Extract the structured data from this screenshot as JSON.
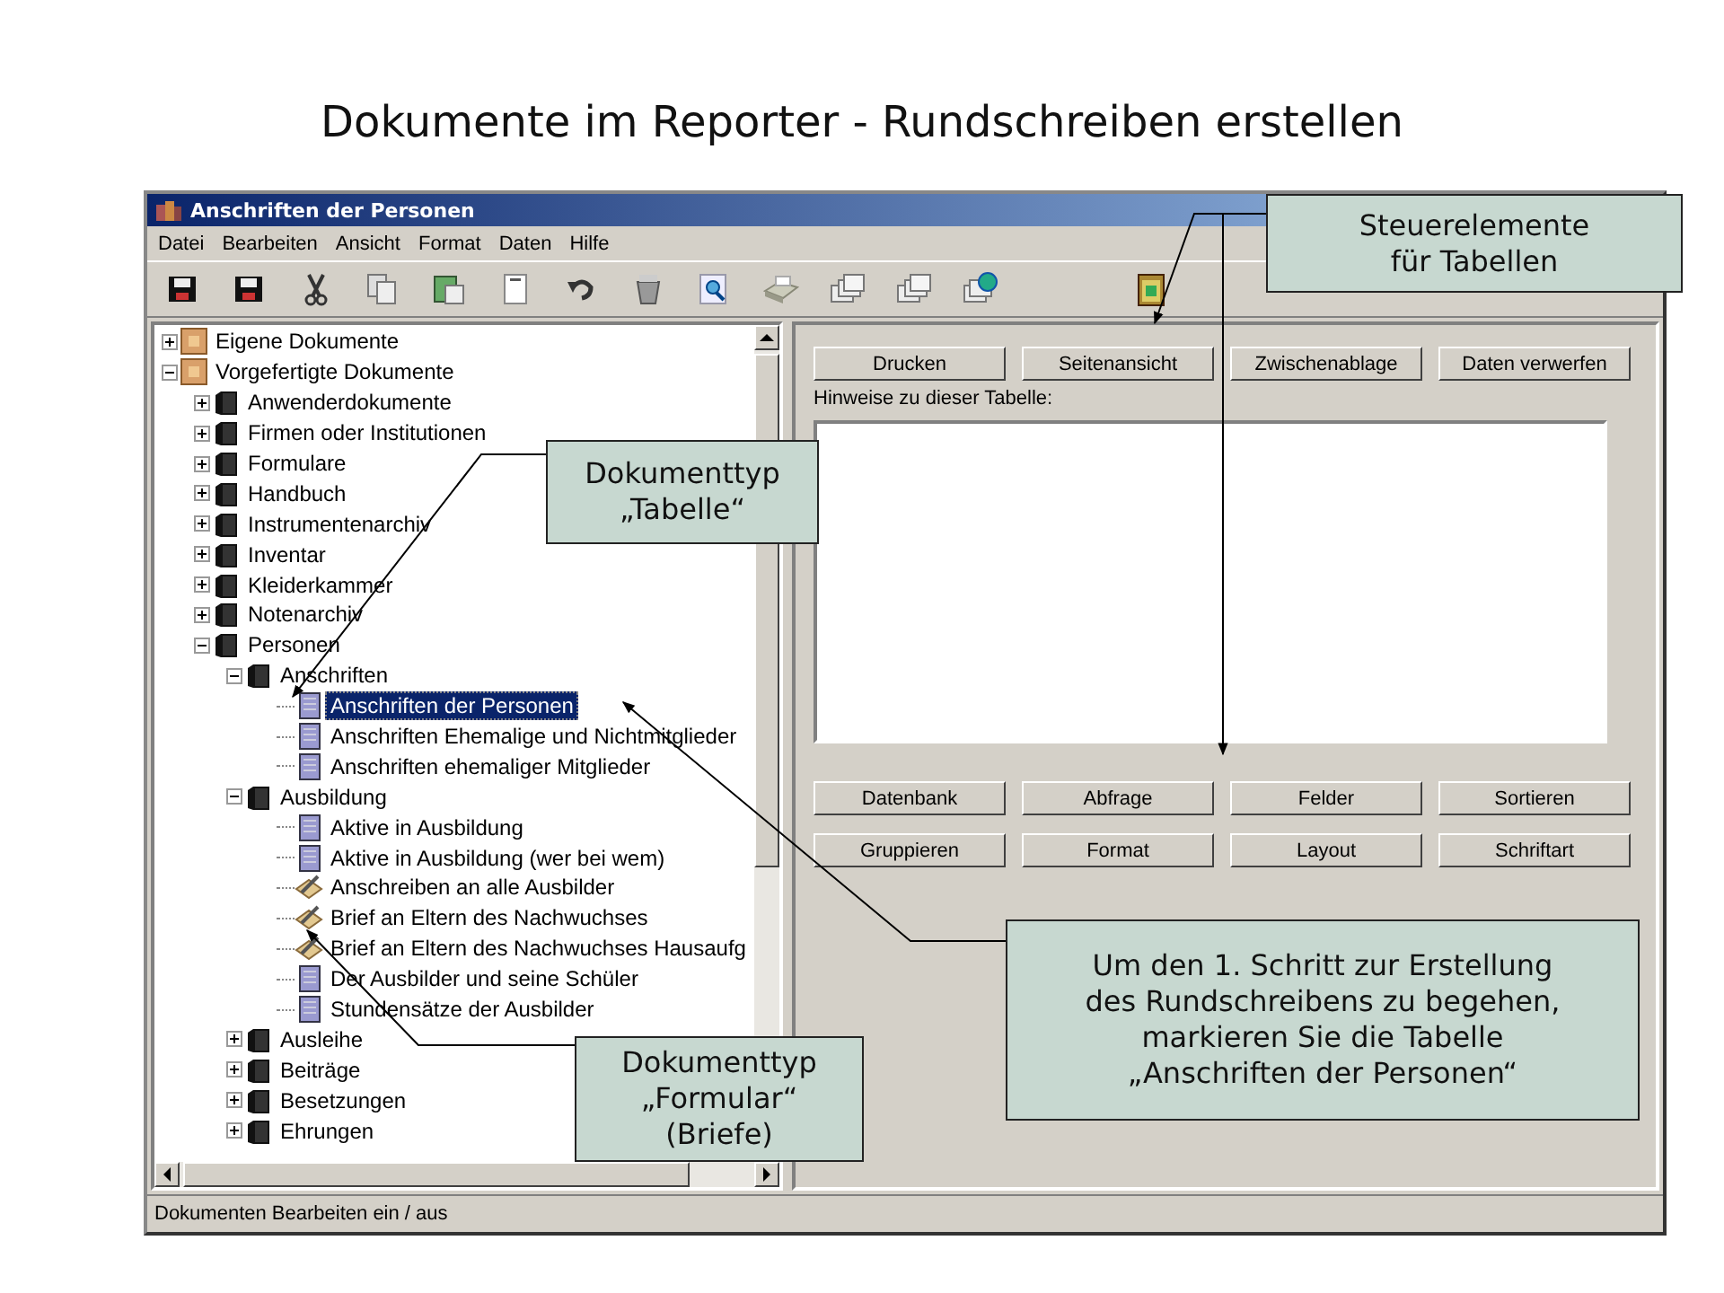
{
  "slide_title": "Dokumente im Reporter - Rundschreiben erstellen",
  "window": {
    "title": "Anschriften der Personen"
  },
  "menu": [
    "Datei",
    "Bearbeiten",
    "Ansicht",
    "Format",
    "Daten",
    "Hilfe"
  ],
  "tree": [
    {
      "label": "Eigene Dokumente",
      "kind": "cabinet",
      "expanded": false,
      "selected": false
    },
    {
      "label": "Vorgefertigte Dokumente",
      "kind": "cabinet",
      "expanded": true,
      "selected": false,
      "children": [
        {
          "label": "Anwenderdokumente",
          "kind": "book",
          "expanded": false,
          "selected": false
        },
        {
          "label": "Firmen oder Institutionen",
          "kind": "book",
          "expanded": false,
          "selected": false
        },
        {
          "label": "Formulare",
          "kind": "book",
          "expanded": false,
          "selected": false
        },
        {
          "label": "Handbuch",
          "kind": "book",
          "expanded": false,
          "selected": false
        },
        {
          "label": "Instrumentenarchiv",
          "kind": "book",
          "expanded": false,
          "selected": false
        },
        {
          "label": "Inventar",
          "kind": "book",
          "expanded": false,
          "selected": false
        },
        {
          "label": "Kleiderkammer",
          "kind": "book",
          "expanded": false,
          "selected": false
        },
        {
          "label": "Notenarchiv",
          "kind": "book",
          "expanded": false,
          "selected": false
        },
        {
          "label": "Personen",
          "kind": "book",
          "expanded": true,
          "selected": false,
          "children": [
            {
              "label": "Anschriften",
              "kind": "book",
              "expanded": true,
              "selected": false,
              "children": [
                {
                  "label": "Anschriften der Personen",
                  "kind": "table",
                  "selected": true
                },
                {
                  "label": "Anschriften Ehemalige und Nichtmitglieder",
                  "kind": "table",
                  "selected": false
                },
                {
                  "label": "Anschriften ehemaliger Mitglieder",
                  "kind": "table",
                  "selected": false
                }
              ]
            },
            {
              "label": "Ausbildung",
              "kind": "book",
              "expanded": true,
              "selected": false,
              "children": [
                {
                  "label": "Aktive in Ausbildung",
                  "kind": "table",
                  "selected": false
                },
                {
                  "label": "Aktive in Ausbildung (wer bei wem)",
                  "kind": "table",
                  "selected": false
                },
                {
                  "label": "Anschreiben an alle Ausbilder",
                  "kind": "letter",
                  "selected": false
                },
                {
                  "label": "Brief an Eltern des Nachwuchses",
                  "kind": "letter",
                  "selected": false
                },
                {
                  "label": "Brief an Eltern des Nachwuchses Hausaufg",
                  "kind": "letter",
                  "selected": false
                },
                {
                  "label": "Der Ausbilder und seine Schüler",
                  "kind": "table",
                  "selected": false
                },
                {
                  "label": "Stundensätze der Ausbilder",
                  "kind": "table",
                  "selected": false
                }
              ]
            },
            {
              "label": "Ausleihe",
              "kind": "book",
              "expanded": false,
              "selected": false
            },
            {
              "label": "Beiträge",
              "kind": "book",
              "expanded": false,
              "selected": false
            },
            {
              "label": "Besetzungen",
              "kind": "book",
              "expanded": false,
              "selected": false
            },
            {
              "label": "Ehrungen",
              "kind": "book",
              "expanded": false,
              "selected": false
            }
          ]
        }
      ]
    }
  ],
  "buttons_top": [
    "Drucken",
    "Seitenansicht",
    "Zwischenablage",
    "Daten verwerfen"
  ],
  "notes_label": "Hinweise zu dieser Tabelle:",
  "button_rows": [
    [
      "Datenbank",
      "Abfrage",
      "Felder",
      "Sortieren"
    ],
    [
      "Gruppieren",
      "Format",
      "Layout",
      "Schriftart"
    ]
  ],
  "status_bar": "Dokumenten Bearbeiten ein / aus",
  "callouts": [
    {
      "lines": [
        "Steuerelemente",
        "für Tabellen"
      ]
    },
    {
      "lines": [
        "Dokumenttyp",
        "„Tabelle“"
      ]
    },
    {
      "lines": [
        "Um den 1. Schritt zur Erstellung",
        "des Rundschreibens zu begehen,",
        "markieren Sie die Tabelle",
        "„Anschriften der Personen“"
      ]
    },
    {
      "lines": [
        "Dokumenttyp",
        "„Formular“",
        "(Briefe)"
      ]
    }
  ]
}
